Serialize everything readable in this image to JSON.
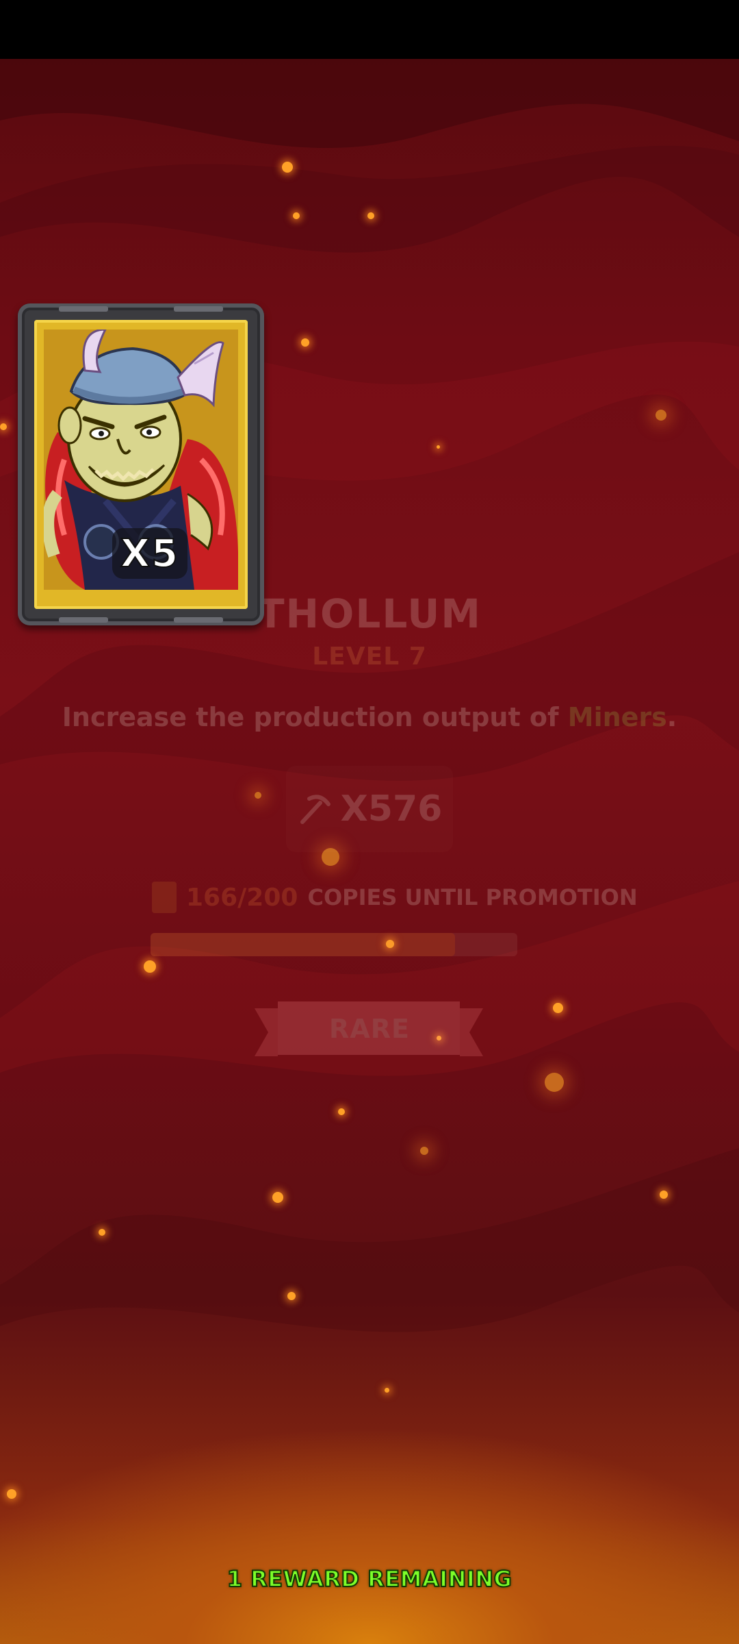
{
  "reward_card": {
    "count_label": "X5",
    "frame_color": "#e1b727"
  },
  "hero": {
    "name": "THOLLUM",
    "level": "LEVEL 7",
    "description_prefix": "Increase the production output of ",
    "description_highlight": "Miners",
    "description_suffix": ".",
    "stat_icon": "pickaxe-icon",
    "stat_value": "X576"
  },
  "promotion": {
    "count": "166/200",
    "label": "COPIES UNTIL PROMOTION",
    "progress": 0.83
  },
  "rarity": {
    "label": "RARE"
  },
  "footer": {
    "rewards_remaining": "1 REWARD REMAINING"
  },
  "colors": {
    "background": "#6e0c14",
    "accent_glow": "#d9800d",
    "reward_text": "#7cff2a"
  }
}
